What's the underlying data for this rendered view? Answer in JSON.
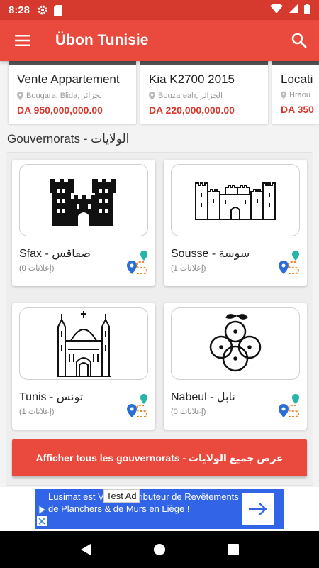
{
  "status_bar": {
    "time": "8:28"
  },
  "app_bar": {
    "title": "Übon Tunisie"
  },
  "listings": [
    {
      "title": "Vente Appartement",
      "location": "Bougara, Blida, الجزائر",
      "price": "DA 950,000,000.00"
    },
    {
      "title": "Kia K2700 2015",
      "location": "Bouzareah, الجزائر",
      "price": "DA 220,000,000.00"
    },
    {
      "title": "Locati",
      "location": "Hraou",
      "price": "DA 350"
    }
  ],
  "section_title": "Gouvernorats - الولايات",
  "governorates": [
    {
      "name": "Sfax - صفاقس",
      "count": "(0 إعلانات)",
      "icon": "castle-icon"
    },
    {
      "name": "Sousse - سوسة",
      "count": "(1 إعلانات)",
      "icon": "fortress-icon"
    },
    {
      "name": "Tunis - تونس",
      "count": "(1 إعلانات)",
      "icon": "cathedral-icon"
    },
    {
      "name": "Nabeul - نابل",
      "count": "(0 إعلانات)",
      "icon": "oranges-icon"
    }
  ],
  "all_button_label": "Afficher tous les gouvernorats - عرض جميع الولايات",
  "ad": {
    "label": "Test Ad",
    "text": "Lusimat est Votre Distributeur de Revêtements de Planchers & de Murs en Liège !"
  },
  "colors": {
    "primary": "#ea4a3e",
    "status_bar": "#d63a2f",
    "price": "#d8372b",
    "ad_background": "#3164e6"
  }
}
